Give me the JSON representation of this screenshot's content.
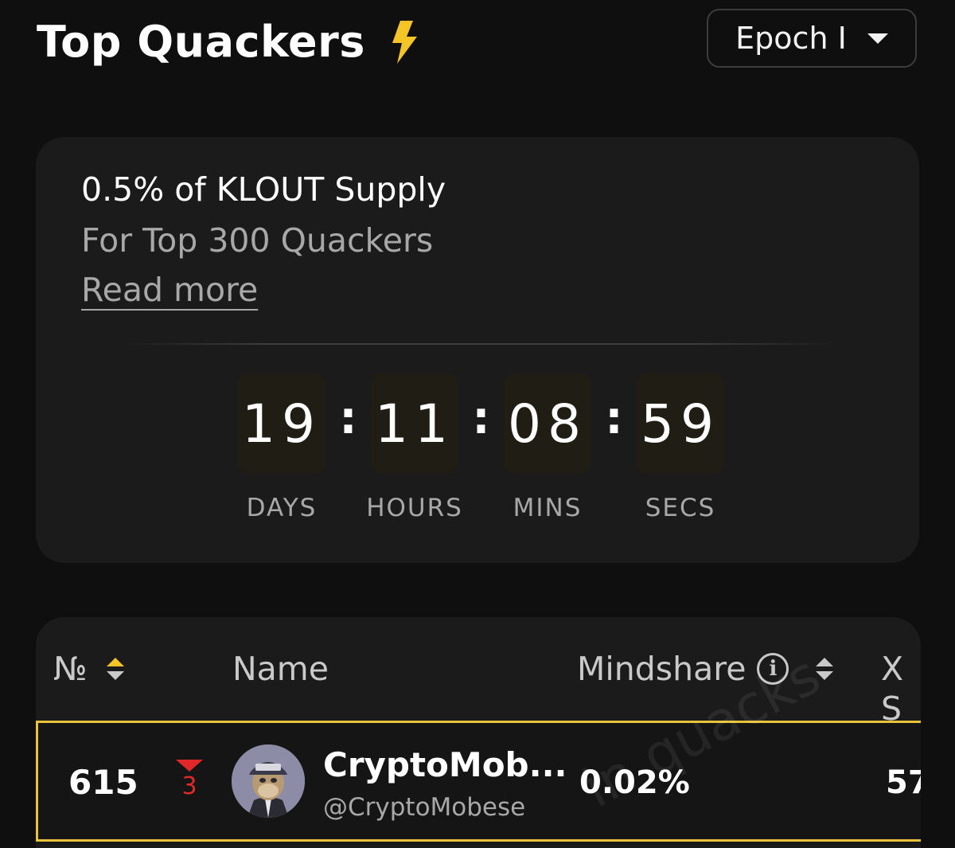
{
  "header": {
    "title": "Top Quackers",
    "title_icon": "lightning-bolt-icon",
    "epoch_selector": {
      "label": "Epoch I",
      "icon": "caret-down-icon"
    }
  },
  "reward": {
    "title": "0.5% of KLOUT Supply",
    "subtitle": "For Top 300 Quackers",
    "read_more": "Read more"
  },
  "countdown": {
    "days": "19",
    "hours": "11",
    "mins": "08",
    "secs": "59",
    "separator": ":",
    "labels": {
      "days": "DAYS",
      "hours": "HOURS",
      "mins": "MINS",
      "secs": "SECS"
    }
  },
  "table": {
    "columns": {
      "rank": "№",
      "name": "Name",
      "mindshare": "Mindshare",
      "x_score": "X S"
    },
    "rows": [
      {
        "rank": "615",
        "change": "3",
        "change_direction": "down",
        "change_color": "#e0282a",
        "display_name": "CryptoMob...",
        "handle": "@CryptoMobese",
        "mindshare": "0.02%",
        "x_score": "57"
      }
    ]
  },
  "colors": {
    "background": "#0f0f0f",
    "card": "#1b1b1b",
    "accent": "#f5c426",
    "highlight_border": "#e8c33a"
  },
  "watermark": "in quacks"
}
